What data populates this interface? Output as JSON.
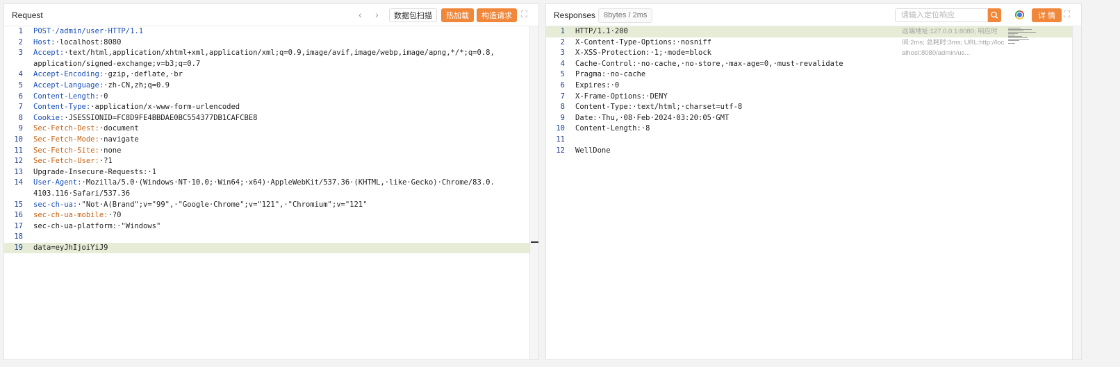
{
  "request": {
    "title": "Request",
    "scan_label": "数据包扫描",
    "hot_load_label": "热加载",
    "build_label": "构造请求",
    "lines": [
      {
        "n": "1",
        "html": "POST·/admin/user·HTTP/1.1",
        "t": "plain_post"
      },
      {
        "n": "2",
        "key": "Host:",
        "val": "·localhost:8080",
        "kc": "blue"
      },
      {
        "n": "3",
        "key": "Accept:",
        "val": "·text/html,application/xhtml+xml,application/xml;q=0.9,image/avif,image/webp,image/apng,*/*;q=0.8,",
        "kc": "blue"
      },
      {
        "n": "",
        "key": "",
        "val": "application/signed-exchange;v=b3;q=0.7",
        "kc": "blue"
      },
      {
        "n": "4",
        "key": "Accept-Encoding:",
        "val": "·gzip,·deflate,·br",
        "kc": "blue"
      },
      {
        "n": "5",
        "key": "Accept-Language:",
        "val": "·zh-CN,zh;q=0.9",
        "kc": "blue"
      },
      {
        "n": "6",
        "key": "Content-Length:",
        "val": "·0",
        "kc": "blue"
      },
      {
        "n": "7",
        "key": "Content-Type:",
        "val": "·application/x-www-form-urlencoded",
        "kc": "blue"
      },
      {
        "n": "8",
        "key": "Cookie:",
        "val": "·JSESSIONID=FC8D9FE4BBDAE0BC554377DB1CAFCBE8",
        "kc": "blue"
      },
      {
        "n": "9",
        "key": "Sec-Fetch-Dest:",
        "val": "·document",
        "kc": "orange"
      },
      {
        "n": "10",
        "key": "Sec-Fetch-Mode:",
        "val": "·navigate",
        "kc": "orange"
      },
      {
        "n": "11",
        "key": "Sec-Fetch-Site:",
        "val": "·none",
        "kc": "orange"
      },
      {
        "n": "12",
        "key": "Sec-Fetch-User:",
        "val": "·?1",
        "kc": "orange"
      },
      {
        "n": "13",
        "key": "Upgrade-Insecure-Requests:",
        "val": "·1",
        "kc": "plain"
      },
      {
        "n": "14",
        "key": "User-Agent:",
        "val": "·Mozilla/5.0·(Windows·NT·10.0;·Win64;·x64)·AppleWebKit/537.36·(KHTML,·like·Gecko)·Chrome/83.0.",
        "kc": "blue"
      },
      {
        "n": "",
        "key": "",
        "val": "4103.116·Safari/537.36",
        "kc": "blue"
      },
      {
        "n": "15",
        "key": "sec-ch-ua:",
        "val": "·\"Not·A(Brand\";v=\"99\",·\"Google·Chrome\";v=\"121\",·\"Chromium\";v=\"121\"",
        "kc": "blue"
      },
      {
        "n": "16",
        "key": "sec-ch-ua-mobile:",
        "val": "·?0",
        "kc": "orange"
      },
      {
        "n": "17",
        "key": "sec-ch-ua-platform:",
        "val": "·\"Windows\"",
        "kc": "plain"
      },
      {
        "n": "18",
        "key": "",
        "val": "",
        "kc": "plain"
      },
      {
        "n": "19",
        "key": "",
        "val": "data=eyJhIjoiYiJ9",
        "kc": "plain",
        "hl": true
      }
    ]
  },
  "response": {
    "title": "Responses",
    "size_tag": "8bytes / 2ms",
    "search_placeholder": "请输入定位响应",
    "detail_label": "详 情",
    "meta_text": "远端地址:127.0.0.1:8080; 响应时间:2ms; 总耗时:3ms; URL:http://localhost:8080/admin/us...",
    "lines": [
      {
        "n": "1",
        "key": "",
        "val": "HTTP/1.1·200",
        "kc": "plain",
        "hl": true
      },
      {
        "n": "2",
        "key": "X-Content-Type-Options:",
        "val": "·nosniff",
        "kc": "plain"
      },
      {
        "n": "3",
        "key": "X-XSS-Protection:",
        "val": "·1;·mode=block",
        "kc": "plain"
      },
      {
        "n": "4",
        "key": "Cache-Control:",
        "val": "·no-cache,·no-store,·max-age=0,·must-revalidate",
        "kc": "plain"
      },
      {
        "n": "5",
        "key": "Pragma:",
        "val": "·no-cache",
        "kc": "plain"
      },
      {
        "n": "6",
        "key": "Expires:",
        "val": "·0",
        "kc": "plain"
      },
      {
        "n": "7",
        "key": "X-Frame-Options:",
        "val": "·DENY",
        "kc": "plain"
      },
      {
        "n": "8",
        "key": "Content-Type:",
        "val": "·text/html;·charset=utf-8",
        "kc": "plain"
      },
      {
        "n": "9",
        "key": "Date:",
        "val": "·Thu,·08·Feb·2024·03:20:05·GMT",
        "kc": "plain"
      },
      {
        "n": "10",
        "key": "Content-Length:",
        "val": "·8",
        "kc": "plain"
      },
      {
        "n": "11",
        "key": "",
        "val": "",
        "kc": "plain"
      },
      {
        "n": "12",
        "key": "",
        "val": "WellDone",
        "kc": "plain"
      }
    ]
  },
  "icons": {
    "prev": "chevron-left-icon",
    "next": "chevron-right-icon",
    "expand": "expand-icon",
    "search": "search-icon",
    "chrome": "chrome-icon"
  },
  "colors": {
    "accent": "#f0873a",
    "key_blue": "#1a4fb8",
    "key_orange": "#c56211",
    "highlight": "#e6ecd6"
  }
}
